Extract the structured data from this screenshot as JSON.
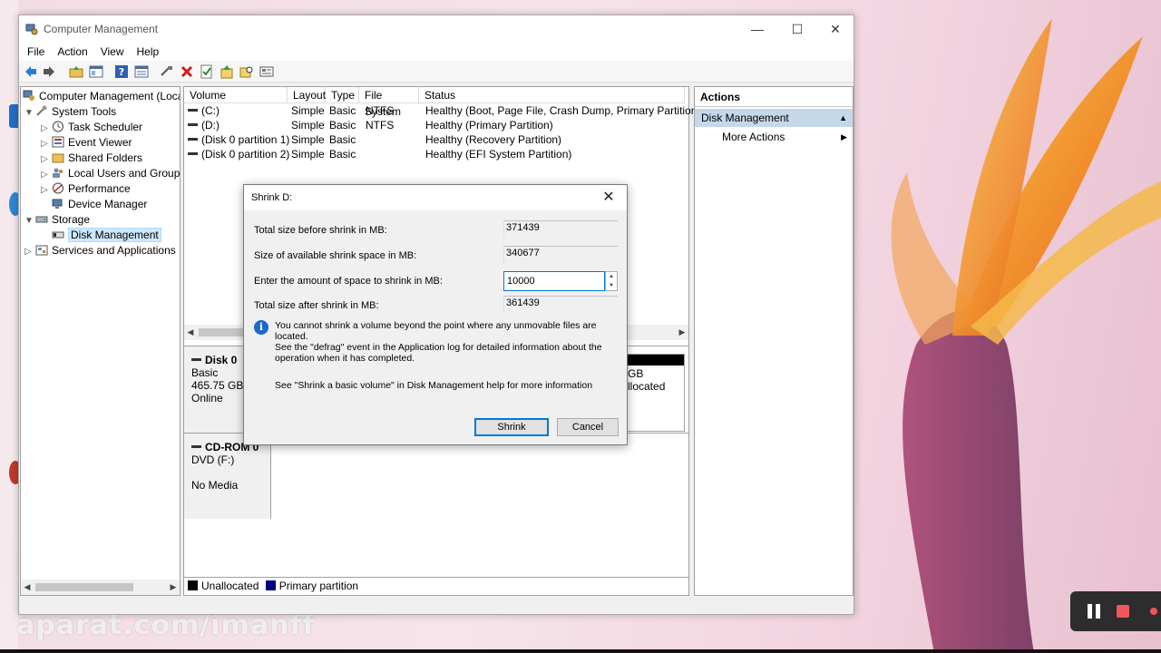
{
  "window": {
    "title": "Computer Management",
    "menu": [
      "File",
      "Action",
      "View",
      "Help"
    ]
  },
  "tree": {
    "root": "Computer Management (Local",
    "items": [
      {
        "label": "System Tools",
        "icon": "tools-icon"
      },
      {
        "label": "Task Scheduler",
        "icon": "clock-icon"
      },
      {
        "label": "Event Viewer",
        "icon": "event-viewer-icon"
      },
      {
        "label": "Shared Folders",
        "icon": "folder-icon"
      },
      {
        "label": "Local Users and Groups",
        "icon": "users-icon"
      },
      {
        "label": "Performance",
        "icon": "performance-icon"
      },
      {
        "label": "Device Manager",
        "icon": "device-manager-icon"
      },
      {
        "label": "Storage",
        "icon": "storage-icon"
      },
      {
        "label": "Disk Management",
        "icon": "disk-icon"
      },
      {
        "label": "Services and Applications",
        "icon": "services-icon"
      }
    ]
  },
  "volumes": {
    "columns": [
      "Volume",
      "Layout",
      "Type",
      "File System",
      "Status"
    ],
    "rows": [
      {
        "volume": "(C:)",
        "layout": "Simple",
        "type": "Basic",
        "fs": "NTFS",
        "status": "Healthy (Boot, Page File, Crash Dump, Primary Partition)"
      },
      {
        "volume": "(D:)",
        "layout": "Simple",
        "type": "Basic",
        "fs": "NTFS",
        "status": "Healthy (Primary Partition)"
      },
      {
        "volume": "(Disk 0 partition 1)",
        "layout": "Simple",
        "type": "Basic",
        "fs": "",
        "status": "Healthy (Recovery Partition)"
      },
      {
        "volume": "(Disk 0 partition 2)",
        "layout": "Simple",
        "type": "Basic",
        "fs": "",
        "status": "Healthy (EFI System Partition)"
      }
    ]
  },
  "disks": {
    "disk0": {
      "name": "Disk 0",
      "type": "Basic",
      "size": "465.75 GB",
      "state": "Online",
      "partial_size": "GB",
      "partial_label": "llocated"
    },
    "cdrom": {
      "name": "CD-ROM 0",
      "type": "DVD (F:)",
      "state": "No Media"
    }
  },
  "legend": {
    "unallocated": "Unallocated",
    "primary": "Primary partition",
    "unallocated_color": "#000000",
    "primary_color": "#00007f"
  },
  "actions": {
    "header": "Actions",
    "section": "Disk Management",
    "more": "More Actions"
  },
  "dialog": {
    "title": "Shrink D:",
    "total_before_label": "Total size before shrink in MB:",
    "total_before_value": "371439",
    "available_label": "Size of available shrink space in MB:",
    "available_value": "340677",
    "amount_label": "Enter the amount of space to shrink in MB:",
    "amount_value": "10000",
    "total_after_label": "Total size after shrink in MB:",
    "total_after_value": "361439",
    "info_line1": "You cannot shrink a volume beyond the point where any unmovable files are located.",
    "info_line2": "See the \"defrag\" event in the Application log for detailed information about the",
    "info_line3": "operation when it has completed.",
    "help": "See \"Shrink a basic volume\" in Disk Management help for more information",
    "shrink_button": "Shrink",
    "cancel_button": "Cancel"
  },
  "watermark": "aparat.com/imanff"
}
